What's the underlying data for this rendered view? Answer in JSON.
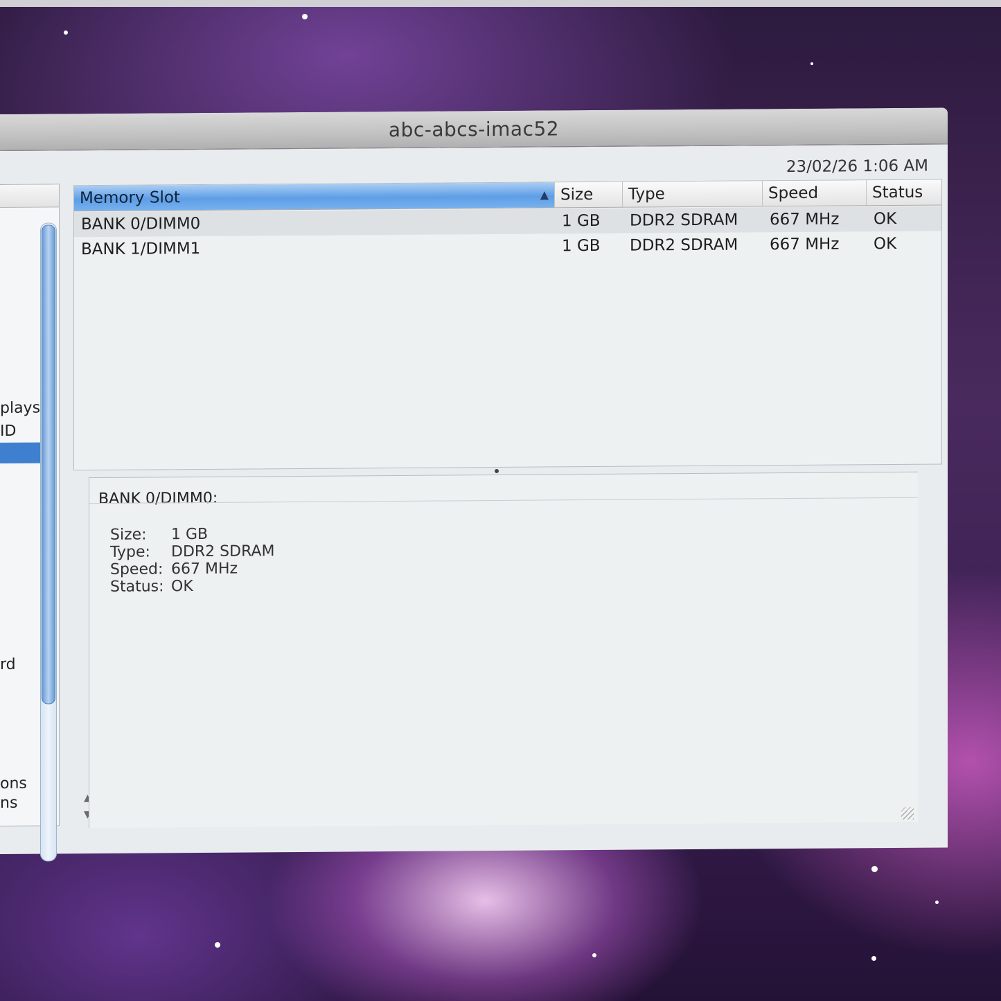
{
  "window": {
    "title": "abc-abcs-imac52"
  },
  "header": {
    "datetime": "23/02/26 1:06 AM"
  },
  "sidebar": {
    "items": [
      {
        "label": "plays"
      },
      {
        "label": "ID"
      },
      {
        "label": "rd"
      },
      {
        "label": "ons"
      },
      {
        "label": "ns"
      }
    ]
  },
  "table": {
    "columns": [
      {
        "label": "Memory Slot"
      },
      {
        "label": "Size"
      },
      {
        "label": "Type"
      },
      {
        "label": "Speed"
      },
      {
        "label": "Status"
      }
    ],
    "rows": [
      {
        "slot": "BANK 0/DIMM0",
        "size": "1 GB",
        "type": "DDR2 SDRAM",
        "speed": "667 MHz",
        "status": "OK"
      },
      {
        "slot": "BANK 1/DIMM1",
        "size": "1 GB",
        "type": "DDR2 SDRAM",
        "speed": "667 MHz",
        "status": "OK"
      }
    ]
  },
  "detail": {
    "title": "BANK 0/DIMM0:",
    "fields": [
      {
        "label": "Size:",
        "value": "1 GB"
      },
      {
        "label": "Type:",
        "value": "DDR2 SDRAM"
      },
      {
        "label": "Speed:",
        "value": "667 MHz"
      },
      {
        "label": "Status:",
        "value": "OK"
      }
    ]
  },
  "colors": {
    "selection": "#3f7fd0",
    "sorted_header": "#5e9ee6"
  }
}
